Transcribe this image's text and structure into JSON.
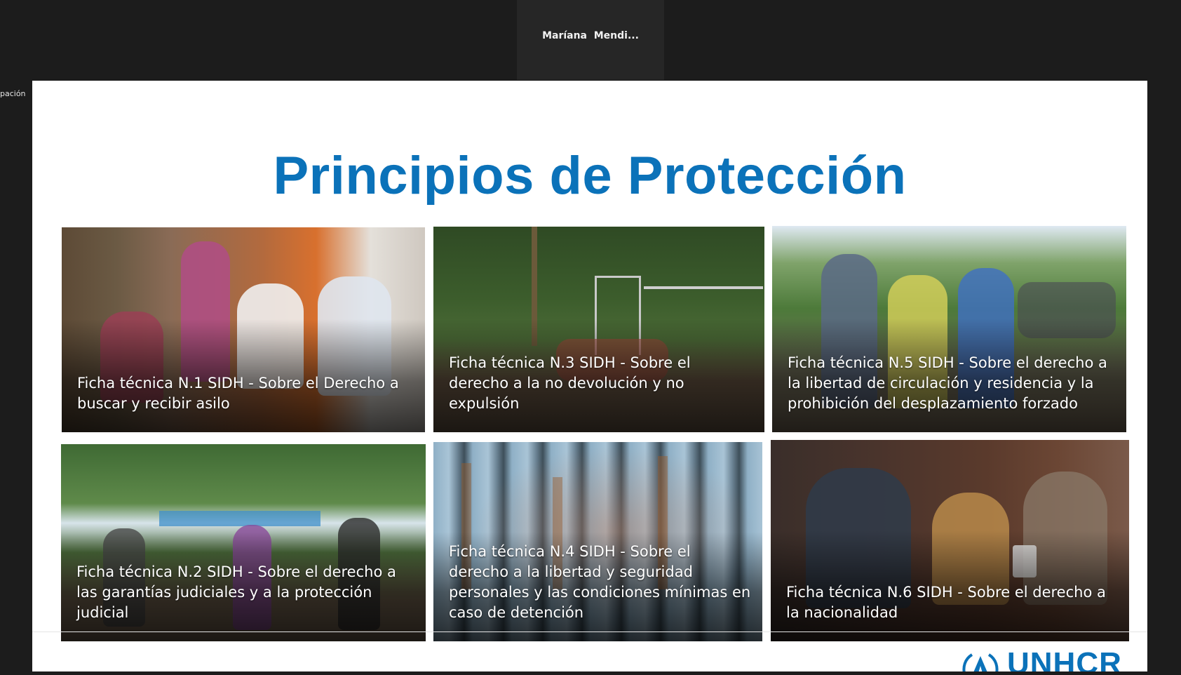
{
  "meeting": {
    "speaker_name": "Maríana  Mendi...",
    "side_label": "pación"
  },
  "slide": {
    "title": "Principios de Protección",
    "cards": [
      {
        "caption": "Ficha técnica N.1 SIDH - Sobre el Derecho a buscar y recibir asilo"
      },
      {
        "caption": "Ficha técnica N.3 SIDH - Sobre el derecho a la no devolución y no expulsión"
      },
      {
        "caption": "Ficha técnica N.5 SIDH - Sobre el derecho a la libertad de circulación y residencia y la prohibición del desplazamiento forzado"
      },
      {
        "caption": "Ficha técnica N.2 SIDH - Sobre el derecho a las garantías judiciales y a la protección judicial"
      },
      {
        "caption": "Ficha técnica N.4 SIDH - Sobre el derecho a la libertad y seguridad personales y las condiciones mínimas en caso de detención"
      },
      {
        "caption": "Ficha técnica N.6 SIDH - Sobre el derecho a la nacionalidad"
      }
    ],
    "logo_text": "UNHCR"
  },
  "colors": {
    "title_blue": "#0b72b9",
    "app_background": "#1c1c1c"
  }
}
